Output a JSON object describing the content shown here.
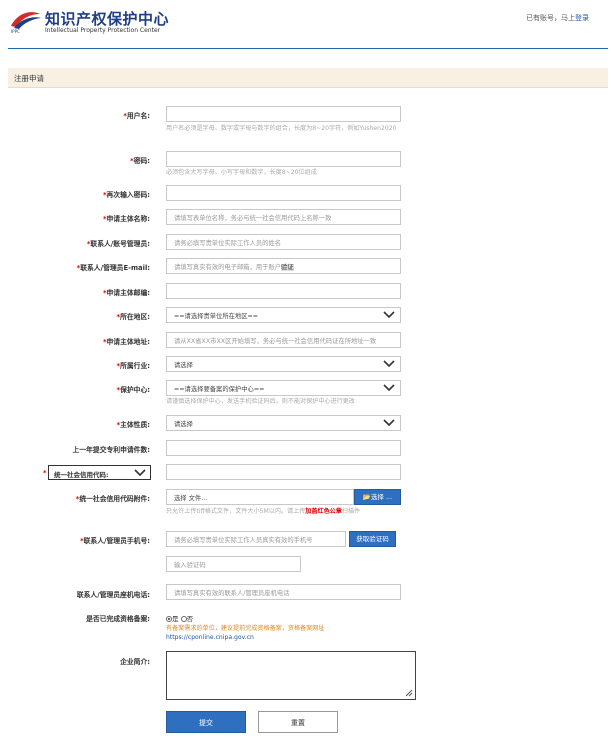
{
  "header": {
    "brand_cn": "知识产权保护中心",
    "brand_en": "Intellectual Property Protection Center",
    "logo_text": "IPPC",
    "login_prompt": "已有账号，马上",
    "login_link": "登录"
  },
  "panel": {
    "title": "注册申请"
  },
  "form": {
    "username": {
      "label": "用户名:",
      "hint": "用户名必须是字母、数字或字母与数字的组合，长度为8~20字符，例如Yushen2020"
    },
    "password": {
      "label": "密码:",
      "hint": "必须包含大写字母、小写字母和数字，长度8~20位组成"
    },
    "password_confirm": {
      "label": "再次输入密码:"
    },
    "applicant_name": {
      "label": "申请主体名称:",
      "placeholder": "请填写表单位名称，务必与统一社会信用代码上名称一致"
    },
    "contact": {
      "label": "联系人/账号管理员:",
      "placeholder": "请务必填写贵单位实际工作人员的姓名"
    },
    "email": {
      "label": "联系人/管理员E-mail:",
      "placeholder": "请填写真实有效的电子邮箱，用于账户",
      "placeholder_tail": "验证"
    },
    "postcode": {
      "label": "申请主体邮编:"
    },
    "region": {
      "label": "所在地区:",
      "value": "==请选择贵单位所在地区=="
    },
    "address": {
      "label": "申请主体地址:",
      "placeholder": "请从XX省XX市XX区开始填写，务必与统一社会信用代码证在所地址一致"
    },
    "industry": {
      "label": "所属行业:",
      "value": "请选择"
    },
    "center": {
      "label": "保护中心:",
      "value": "==请选择要备案的保护中心==",
      "hint": "请谨慎选择保护中心，发送手机验证码后，则不能对保护中心进行更改"
    },
    "nature": {
      "label": "主体性质:",
      "value": "请选择"
    },
    "patent_count": {
      "label": "上一年提交专利申请件数:"
    },
    "credit_code": {
      "label": "统一社会信用代码:"
    },
    "attachment": {
      "label": "统一社会信用代码附件:",
      "placeholder": "选择 文件...",
      "button": "选择 ...",
      "hint_pre": "只允许上传tiff格式文件，文件大小5M以内。请上传",
      "hint_red": "加盖红色公章",
      "hint_post": "扫描件"
    },
    "phone": {
      "label": "联系人/管理员手机号:",
      "placeholder": "请务必填写贵单位实际工作人员真实有效的手机号",
      "button": "获取验证码",
      "code_placeholder": "输入验证码"
    },
    "landline": {
      "label": "联系人/管理员座机电话:",
      "placeholder": "请填写真实有效的联系人/管理员座机电话"
    },
    "filed": {
      "label": "是否已完成资格备案:",
      "yes": "是",
      "no": "否",
      "hint": "有备案需求的单位，建议提前完成资格备案，资格备案网址",
      "url": "https://cponline.cnipa.gov.cn"
    },
    "intro": {
      "label": "企业简介:"
    },
    "submit": "提交",
    "reset": "重置",
    "required_mark": "*"
  }
}
